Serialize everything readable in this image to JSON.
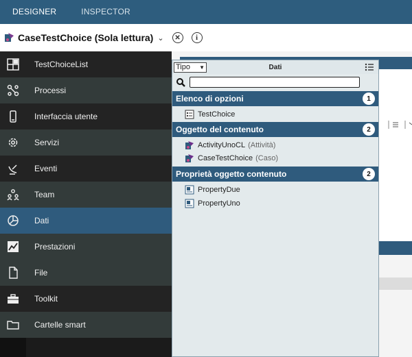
{
  "tabs": [
    {
      "label": "DESIGNER"
    },
    {
      "label": "INSPECTOR"
    }
  ],
  "titlebar": {
    "title": "CaseTestChoice (Sola lettura)",
    "chevron": "⌄",
    "close_glyph": "✕",
    "info_glyph": "i"
  },
  "sidebar": {
    "items": [
      {
        "label": "TestChoiceList",
        "icon": "layout-icon"
      },
      {
        "label": "Processi",
        "icon": "process-icon"
      },
      {
        "label": "Interfaccia utente",
        "icon": "phone-icon"
      },
      {
        "label": "Servizi",
        "icon": "gear-icon"
      },
      {
        "label": "Eventi",
        "icon": "satellite-icon"
      },
      {
        "label": "Team",
        "icon": "team-icon"
      },
      {
        "label": "Dati",
        "icon": "pie-icon"
      },
      {
        "label": "Prestazioni",
        "icon": "trend-icon"
      },
      {
        "label": "File",
        "icon": "file-icon"
      },
      {
        "label": "Toolkit",
        "icon": "toolbox-icon"
      },
      {
        "label": "Cartelle smart",
        "icon": "folder-icon"
      }
    ],
    "active_index": 6
  },
  "popup": {
    "type_select": "Tipo",
    "title": "Dati",
    "search": {
      "value": "",
      "placeholder": ""
    },
    "sections": [
      {
        "label": "Elenco di opzioni",
        "count": "1",
        "items": [
          {
            "label": "TestChoice",
            "sub": ""
          }
        ]
      },
      {
        "label": "Oggetto del contenuto",
        "count": "2",
        "items": [
          {
            "label": "ActivityUnoCL",
            "sub": "(Attività)"
          },
          {
            "label": "CaseTestChoice",
            "sub": "(Caso)"
          }
        ]
      },
      {
        "label": "Proprietà oggetto contenuto",
        "count": "2",
        "items": [
          {
            "label": "PropertyDue",
            "sub": ""
          },
          {
            "label": "PropertyUno",
            "sub": ""
          }
        ]
      }
    ]
  },
  "colors": {
    "topbar": "#2e5d7e",
    "sidebar_active": "#2f5b7d",
    "section_header": "#2f5b7d",
    "popup_bg": "#e3eaec"
  }
}
